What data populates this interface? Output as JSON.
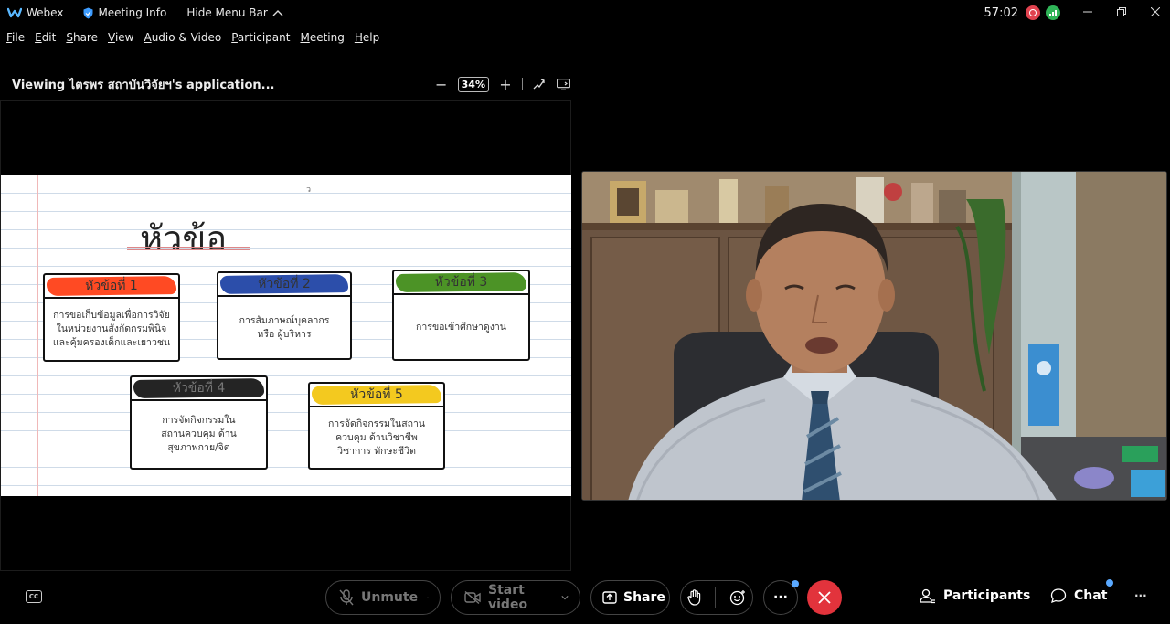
{
  "titlebar": {
    "app_name": "Webex",
    "meeting_info": "Meeting Info",
    "hide_menu_bar": "Hide Menu Bar",
    "timer": "57:02"
  },
  "menu": {
    "items": [
      {
        "label": "File",
        "accel": "F",
        "rest": "ile"
      },
      {
        "label": "Edit",
        "accel": "E",
        "rest": "dit"
      },
      {
        "label": "Share",
        "accel": "S",
        "rest": "hare"
      },
      {
        "label": "View",
        "accel": "V",
        "rest": "iew"
      },
      {
        "label": "Audio & Video",
        "accel": "A",
        "rest": "udio & Video"
      },
      {
        "label": "Participant",
        "accel": "P",
        "rest": "articipant"
      },
      {
        "label": "Meeting",
        "accel": "M",
        "rest": "eeting"
      },
      {
        "label": "Help",
        "accel": "H",
        "rest": "elp"
      }
    ]
  },
  "share": {
    "viewing_label": "Viewing ไตรพร สถาบันวิจัยฯ's application...",
    "zoom_minus": "−",
    "zoom_level": "34%",
    "zoom_plus": "+"
  },
  "slide": {
    "title": "หัวข้อ",
    "cursor_mark": "ว",
    "cards": [
      {
        "head": "หัวข้อที่ 1",
        "body": "การขอเก็บข้อมูลเพื่อการวิจัย\nในหน่วยงานสังกัดกรมพินิจ\nและคุ้มครองเด็กและเยาวชน",
        "color": "#ff3b10"
      },
      {
        "head": "หัวข้อที่ 2",
        "body": "การสัมภาษณ์บุคลากร\nหรือ ผู้บริหาร",
        "color": "#1a3fa3"
      },
      {
        "head": "หัวข้อที่ 3",
        "body": "การขอเข้าศึกษาดูงาน",
        "color": "#3d8a14"
      },
      {
        "head": "หัวข้อที่ 4",
        "body": "การจัดกิจกรรมใน\nสถานควบคุม ด้าน\nสุขภาพกาย/จิต",
        "color": "#111111"
      },
      {
        "head": "หัวข้อที่ 5",
        "body": "การจัดกิจกรรมในสถาน\nควบคุม ด้านวิชาชีพ\nวิชาการ ทักษะชีวิต",
        "color": "#f2c40c"
      }
    ]
  },
  "controls": {
    "unmute": "Unmute",
    "start_video": "Start video",
    "share": "Share",
    "more": "···",
    "participants": "Participants",
    "chat": "Chat",
    "overflow": "···"
  },
  "colors": {
    "end_call": "#e2333c",
    "badge": "#5aa9ff",
    "recording": "#e0424f",
    "connection": "#2fb457"
  }
}
